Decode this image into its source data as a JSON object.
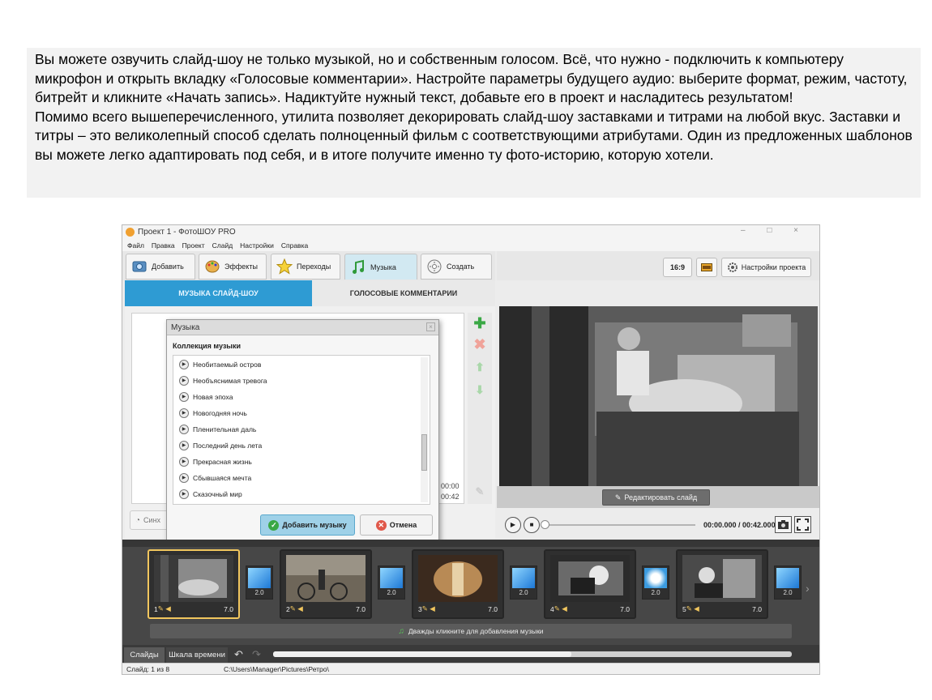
{
  "text_block": {
    "paragraph1": "Вы можете озвучить слайд-шоу  не только музыкой, но и собственным голосом. Всё, что нужно - подключить к компьютеру микрофон и открыть вкладку «Голосовые комментарии». Настройте параметры будущего аудио: выберите формат, режим, частоту, битрейт и кликните «Начать запись». Надиктуйте нужный текст, добавьте его в проект и насладитесь результатом!",
    "paragraph2": "Помимо всего вышеперечисленного, утилита позволяет декорировать слайд-шоу заставками и титрами на любой вкус. Заставки и титры – это великолепный способ сделать полноценный фильм с соответствующими атрибутами. Один из предложенных шаблонов вы можете легко адаптировать под себя, и в итоге получите именно ту фото-историю, которую хотели."
  },
  "window": {
    "title": "Проект 1 - ФотоШОУ PRO",
    "controls": "– □ ×"
  },
  "menu": [
    "Файл",
    "Правка",
    "Проект",
    "Слайд",
    "Настройки",
    "Справка"
  ],
  "main_tabs": [
    {
      "label": "Добавить",
      "icon": "photo-icon"
    },
    {
      "label": "Эффекты",
      "icon": "palette-icon"
    },
    {
      "label": "Переходы",
      "icon": "star-icon"
    },
    {
      "label": "Музыка",
      "icon": "music-note-icon",
      "active": true
    },
    {
      "label": "Создать",
      "icon": "disc-icon"
    }
  ],
  "right_toolbar": {
    "aspect": "16:9",
    "settings": "Настройки проекта"
  },
  "subtabs": {
    "music": "МУЗЫКА СЛАЙД-ШОУ",
    "voice": "ГОЛОСОВЫЕ КОММЕНТАРИИ"
  },
  "left_panel": {
    "time1": "00:00",
    "time2": "00:42",
    "sync_label": "Синх"
  },
  "dialog": {
    "title": "Музыка",
    "heading": "Коллекция музыки",
    "tracks": [
      "Необитаемый остров",
      "Необъяснимая тревога",
      "Новая эпоха",
      "Новогодняя ночь",
      "Пленительная даль",
      "Последний день лета",
      "Прекрасная жизнь",
      "Сбывшаяся мечта",
      "Сказочный мир"
    ],
    "add_button": "Добавить музыку",
    "cancel_button": "Отмена"
  },
  "preview": {
    "edit_button": "Редактировать слайд",
    "timecode": "00:00.000 / 00:42.000"
  },
  "filmstrip": {
    "slides": [
      {
        "num": "1",
        "duration": "7.0",
        "selected": true
      },
      {
        "num": "2",
        "duration": "7.0"
      },
      {
        "num": "3",
        "duration": "7.0"
      },
      {
        "num": "4",
        "duration": "7.0"
      },
      {
        "num": "5",
        "duration": "7.0"
      }
    ],
    "transitions": [
      "2.0",
      "2.0",
      "2.0",
      "2.0",
      "2.0"
    ],
    "music_hint": "Дважды кликните для добавления музыки"
  },
  "bottom_tabs": {
    "slides": "Слайды",
    "timeline": "Шкала времени"
  },
  "status": {
    "slide": "Слайд: 1 из 8",
    "path": "C:\\Users\\Manager\\Pictures\\Ретро\\"
  },
  "colors": {
    "accent": "#2e9bd3",
    "selected_slide": "#f1c65e",
    "add_green": "#3aa845",
    "remove_red": "#e0584a"
  }
}
